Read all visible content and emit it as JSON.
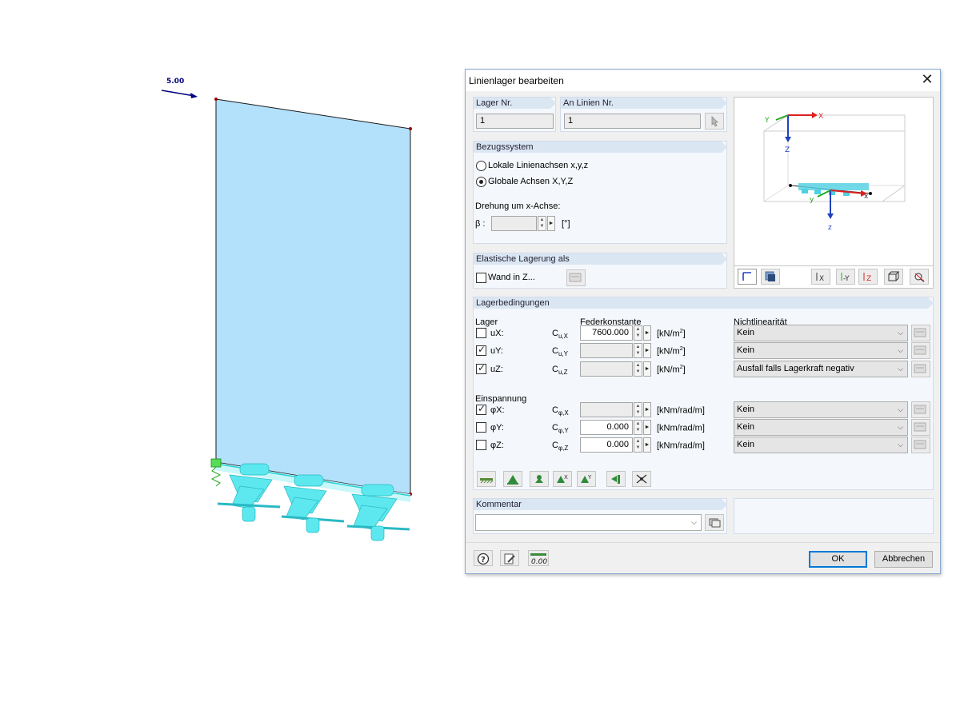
{
  "model": {
    "load_value": "5.00"
  },
  "dialog": {
    "title": "Linienlager bearbeiten",
    "close_symbol": "✕",
    "lager_nr": {
      "label": "Lager Nr.",
      "value": "1"
    },
    "an_linien": {
      "label": "An Linien Nr.",
      "value": "1"
    },
    "bezugssystem": {
      "heading": "Bezugssystem",
      "options": [
        "Lokale Linienachsen x,y,z",
        "Globale Achsen X,Y,Z"
      ],
      "selected_index": 1,
      "drehung_label": "Drehung um x-Achse:",
      "beta_label": "β :",
      "beta_unit": "[°]"
    },
    "elastische": {
      "heading": "Elastische Lagerung als",
      "checkbox_label": "Wand in Z..."
    },
    "preview": {
      "axis_labels": {
        "x1": "X",
        "y1": "Y",
        "z1": "Z",
        "x2": "x",
        "y2": "y",
        "z2": "z"
      }
    },
    "lagerbedingungen": {
      "heading": "Lagerbedingungen",
      "col_lager": "Lager",
      "col_feder": "Federkonstante",
      "col_nonlin": "Nichtlinearität",
      "einspannung_label": "Einspannung",
      "rows": [
        {
          "name": "ux",
          "label": "uX:",
          "checked": false,
          "c_main": "C",
          "c_sub": "u,X",
          "value": "7600.000",
          "unit_base": "[kN/m",
          "unit_sup": "2",
          "unit_end": "]",
          "nonlin": "Kein",
          "enabled": true
        },
        {
          "name": "uy",
          "label": "uY:",
          "checked": true,
          "c_main": "C",
          "c_sub": "u,Y",
          "value": "",
          "unit_base": "[kN/m",
          "unit_sup": "2",
          "unit_end": "]",
          "nonlin": "Kein",
          "enabled": false
        },
        {
          "name": "uz",
          "label": "uZ:",
          "checked": true,
          "c_main": "C",
          "c_sub": "u,Z",
          "value": "",
          "unit_base": "[kN/m",
          "unit_sup": "2",
          "unit_end": "]",
          "nonlin": "Ausfall falls Lagerkraft negativ",
          "enabled": false
        },
        {
          "name": "phix",
          "label": "φX:",
          "checked": true,
          "c_main": "C",
          "c_sub": "φ,X",
          "value": "",
          "unit_base": "[kNm/rad/m]",
          "unit_sup": "",
          "unit_end": "",
          "nonlin": "Kein",
          "enabled": false
        },
        {
          "name": "phiy",
          "label": "φY:",
          "checked": false,
          "c_main": "C",
          "c_sub": "φ,Y",
          "value": "0.000",
          "unit_base": "[kNm/rad/m]",
          "unit_sup": "",
          "unit_end": "",
          "nonlin": "Kein",
          "enabled": true
        },
        {
          "name": "phiz",
          "label": "φZ:",
          "checked": false,
          "c_main": "C",
          "c_sub": "φ,Z",
          "value": "0.000",
          "unit_base": "[kNm/rad/m]",
          "unit_sup": "",
          "unit_end": "",
          "nonlin": "Kein",
          "enabled": true
        }
      ]
    },
    "kommentar": {
      "heading": "Kommentar",
      "value": ""
    },
    "footer": {
      "ok_label": "OK",
      "cancel_label": "Abbrechen",
      "calc_icon_text": "0.00"
    },
    "colors": {
      "accent": "#0078d7",
      "group_header": "#dbe6f3",
      "wall_fill": "#b3e0fb",
      "support_cyan": "#5ce8ee"
    }
  }
}
